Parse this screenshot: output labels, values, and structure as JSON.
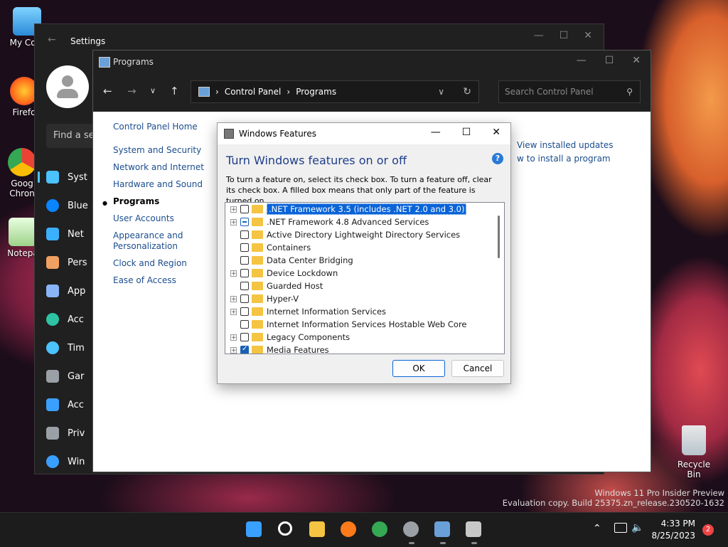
{
  "desktop": {
    "icons": [
      {
        "label": "My Com"
      },
      {
        "label": "Firefo"
      },
      {
        "label": "Goog Chron"
      },
      {
        "label": "Notepa"
      }
    ],
    "recycle_bin": "Recycle Bin",
    "watermark_line1": "Windows 11 Pro Insider Preview",
    "watermark_line2": "Evaluation copy. Build 25375.zn_release.230520-1632"
  },
  "settings": {
    "title": "Settings",
    "search_placeholder": "Find a se",
    "nav": [
      {
        "label": "Syst",
        "icon": "system-icon",
        "color": "#4cc2ff"
      },
      {
        "label": "Blue",
        "icon": "bluetooth-icon",
        "color": "#0a84ff"
      },
      {
        "label": "Net",
        "icon": "network-icon",
        "color": "#3ab0ff"
      },
      {
        "label": "Pers",
        "icon": "personalization-icon",
        "color": "#f0a060"
      },
      {
        "label": "App",
        "icon": "apps-icon",
        "color": "#8ab4f8"
      },
      {
        "label": "Acc",
        "icon": "accounts-icon",
        "color": "#2dc3a4"
      },
      {
        "label": "Tim",
        "icon": "time-icon",
        "color": "#4cc2ff"
      },
      {
        "label": "Gar",
        "icon": "gaming-icon",
        "color": "#9aa0a6"
      },
      {
        "label": "Acc",
        "icon": "accessibility-icon",
        "color": "#3aa0ff"
      },
      {
        "label": "Priv",
        "icon": "privacy-icon",
        "color": "#9aa0a6"
      },
      {
        "label": "Win",
        "icon": "update-icon",
        "color": "#3aa0ff"
      }
    ]
  },
  "programs": {
    "title": "Programs",
    "breadcrumb": [
      "Control Panel",
      "Programs"
    ],
    "search_placeholder": "Search Control Panel",
    "left_nav": {
      "home": "Control Panel Home",
      "items": [
        "System and Security",
        "Network and Internet",
        "Hardware and Sound",
        "Programs",
        "User Accounts",
        "Appearance and Personalization",
        "Clock and Region",
        "Ease of Access"
      ]
    },
    "links": [
      "View installed updates",
      "w to install a program"
    ]
  },
  "dialog": {
    "title": "Windows Features",
    "heading": "Turn Windows features on or off",
    "description": "To turn a feature on, select its check box. To turn a feature off, clear its check box. A filled box means that only part of the feature is turned on.",
    "features": [
      {
        "label": ".NET Framework 3.5 (includes .NET 2.0 and 3.0)",
        "expandable": true,
        "state": "unchecked",
        "highlight": true
      },
      {
        "label": ".NET Framework 4.8 Advanced Services",
        "expandable": true,
        "state": "partial",
        "highlight": false
      },
      {
        "label": "Active Directory Lightweight Directory Services",
        "expandable": false,
        "state": "unchecked",
        "highlight": false
      },
      {
        "label": "Containers",
        "expandable": false,
        "state": "unchecked",
        "highlight": false
      },
      {
        "label": "Data Center Bridging",
        "expandable": false,
        "state": "unchecked",
        "highlight": false
      },
      {
        "label": "Device Lockdown",
        "expandable": true,
        "state": "unchecked",
        "highlight": false
      },
      {
        "label": "Guarded Host",
        "expandable": false,
        "state": "unchecked",
        "highlight": false
      },
      {
        "label": "Hyper-V",
        "expandable": true,
        "state": "unchecked",
        "highlight": false
      },
      {
        "label": "Internet Information Services",
        "expandable": true,
        "state": "unchecked",
        "highlight": false
      },
      {
        "label": "Internet Information Services Hostable Web Core",
        "expandable": false,
        "state": "unchecked",
        "highlight": false
      },
      {
        "label": "Legacy Components",
        "expandable": true,
        "state": "unchecked",
        "highlight": false
      },
      {
        "label": "Media Features",
        "expandable": true,
        "state": "checked",
        "highlight": false
      }
    ],
    "ok_label": "OK",
    "cancel_label": "Cancel"
  },
  "taskbar": {
    "apps": [
      {
        "icon": "start-icon",
        "color": "#3aa0ff",
        "active": false
      },
      {
        "icon": "search-icon",
        "color": "#ffffff",
        "active": false
      },
      {
        "icon": "file-explorer-icon",
        "color": "#f4c442",
        "active": false
      },
      {
        "icon": "firefox-icon",
        "color": "#ff7a1a",
        "active": false
      },
      {
        "icon": "chrome-icon",
        "color": "#34a853",
        "active": false
      },
      {
        "icon": "settings-icon",
        "color": "#9aa0a6",
        "active": true
      },
      {
        "icon": "control-panel-icon",
        "color": "#6aa0d8",
        "active": true
      },
      {
        "icon": "windows-features-icon",
        "color": "#c8c8c8",
        "active": true
      }
    ],
    "time": "4:33 PM",
    "date": "8/25/2023",
    "notification_count": "2"
  }
}
